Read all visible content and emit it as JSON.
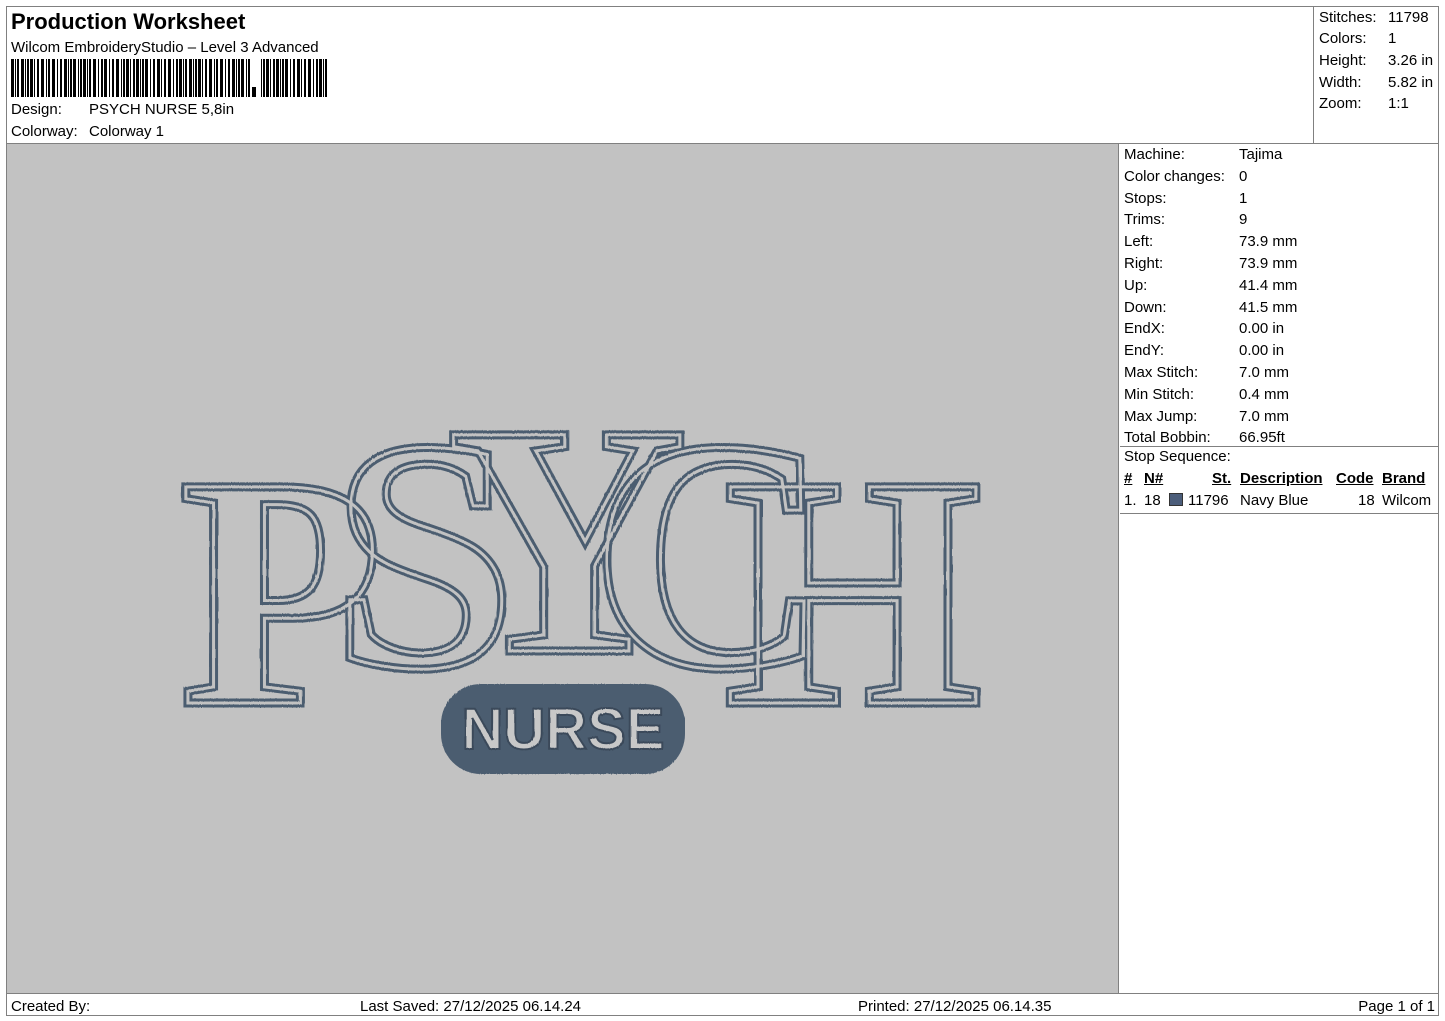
{
  "header": {
    "title": "Production Worksheet",
    "subtitle": "Wilcom EmbroideryStudio – Level 3 Advanced",
    "design_label": "Design:",
    "design_value": "PSYCH NURSE 5,8in",
    "colorway_label": "Colorway:",
    "colorway_value": "Colorway 1"
  },
  "summary": {
    "stitches_label": "Stitches:",
    "stitches_value": "11798",
    "colors_label": "Colors:",
    "colors_value": "1",
    "height_label": "Height:",
    "height_value": "3.26 in",
    "width_label": "Width:",
    "width_value": "5.82 in",
    "zoom_label": "Zoom:",
    "zoom_value": "1:1"
  },
  "design": {
    "main_text": "PSYCH",
    "badge_text": "NURSE",
    "thread_color": "#4b5d70",
    "fabric_color": "#c2c2c2"
  },
  "machine": {
    "rows": [
      {
        "label": "Machine:",
        "value": "Tajima"
      },
      {
        "label": "Color changes:",
        "value": "0"
      },
      {
        "label": "Stops:",
        "value": "1"
      },
      {
        "label": "Trims:",
        "value": "9"
      },
      {
        "label": "Left:",
        "value": "73.9 mm"
      },
      {
        "label": "Right:",
        "value": "73.9 mm"
      },
      {
        "label": "Up:",
        "value": "41.4 mm"
      },
      {
        "label": "Down:",
        "value": "41.5 mm"
      },
      {
        "label": "EndX:",
        "value": "0.00 in"
      },
      {
        "label": "EndY:",
        "value": "0.00 in"
      },
      {
        "label": "Max Stitch:",
        "value": "7.0 mm"
      },
      {
        "label": "Min Stitch:",
        "value": "0.4 mm"
      },
      {
        "label": "Max Jump:",
        "value": "7.0 mm"
      },
      {
        "label": "Total Bobbin:",
        "value": "66.95ft"
      }
    ]
  },
  "stop_sequence": {
    "title": "Stop Sequence:",
    "columns": [
      "#",
      "N#",
      "St.",
      "Description",
      "Code",
      "Brand"
    ],
    "rows": [
      {
        "index": "1.",
        "needle": "18",
        "color": "#4b5d7a",
        "stitches": "11796",
        "description": "Navy Blue",
        "code": "18",
        "brand": "Wilcom"
      }
    ]
  },
  "footer": {
    "created_by": "Created By:",
    "last_saved": "Last Saved: 27/12/2025 06.14.24",
    "printed": "Printed: 27/12/2025 06.14.35",
    "page": "Page 1 of 1"
  }
}
